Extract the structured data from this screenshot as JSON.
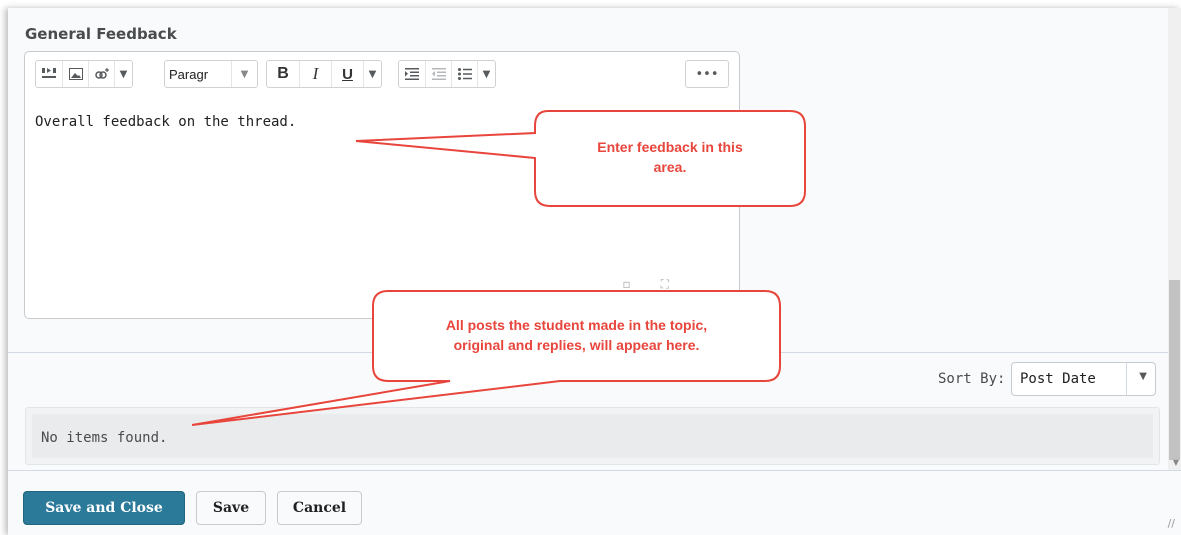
{
  "feedback": {
    "title": "General Feedback",
    "toolbar": {
      "format_value": "Paragr",
      "bold": "B",
      "italic": "I",
      "underline": "U",
      "more": "•••"
    },
    "content": "Overall feedback on the thread."
  },
  "posts": {
    "sort_label": "Sort By:",
    "sort_value": "Post Date",
    "empty_message": "No items found."
  },
  "callouts": {
    "editor_hint": [
      "Enter feedback in this",
      "area."
    ],
    "posts_hint": [
      "All posts the student made in the topic,",
      "original and replies, will appear here."
    ],
    "color": "#e8453c"
  },
  "footer": {
    "save_close": "Save and Close",
    "save": "Save",
    "cancel": "Cancel"
  },
  "colors": {
    "primary_button": "#2b7a99"
  }
}
